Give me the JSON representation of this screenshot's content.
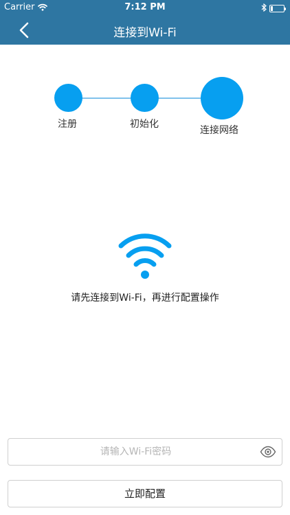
{
  "status_bar": {
    "carrier": "Carrier",
    "time": "7:12 PM",
    "bluetooth_icon": "bluetooth-icon",
    "battery_level": 0.15
  },
  "nav": {
    "title": "连接到Wi-Fi",
    "back_icon": "chevron-left-icon",
    "color": "#2e76a2"
  },
  "steps": [
    {
      "label": "注册",
      "state": "done"
    },
    {
      "label": "初始化",
      "state": "done"
    },
    {
      "label": "连接网络",
      "state": "current"
    }
  ],
  "step_color": "#079ff0",
  "main": {
    "icon": "wifi-icon",
    "hint": "请先连接到Wi-Fi，再进行配置操作"
  },
  "password": {
    "value": "",
    "placeholder": "请输入Wi-Fi密码",
    "toggle_icon": "eye-icon"
  },
  "config_button": {
    "label": "立即配置"
  }
}
